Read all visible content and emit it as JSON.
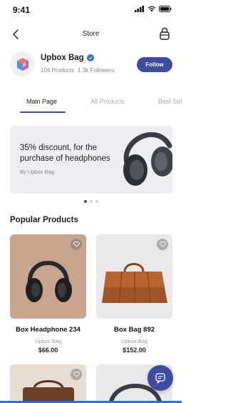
{
  "status": {
    "time": "9:41"
  },
  "nav": {
    "title": "Store",
    "back_icon": "chevron-left-icon",
    "bag_icon": "shopping-bag-icon"
  },
  "store": {
    "name": "Upbox Bag",
    "products": "104 Products",
    "followers": "1.3k Followers",
    "follow_label": "Follow"
  },
  "tabs": [
    {
      "label": "Main Page",
      "active": true
    },
    {
      "label": "All Products",
      "active": false
    },
    {
      "label": "Best Sel",
      "active": false
    }
  ],
  "banner": {
    "title": "35% discount, for the purchase of headphones",
    "subtitle": "By Upbox Bag",
    "dots": 3,
    "active_dot": 1
  },
  "section": {
    "title": "Popular Products"
  },
  "products": [
    {
      "name": "Box Headphone 234",
      "store": "Upbox Bag",
      "price": "$66.00"
    },
    {
      "name": "Box Bag 892",
      "store": "Upbox Bag",
      "price": "$152.00"
    }
  ],
  "colors": {
    "accent": "#3d4c9e",
    "verified": "#2f6fd8",
    "banner_bg": "#eceef2"
  }
}
